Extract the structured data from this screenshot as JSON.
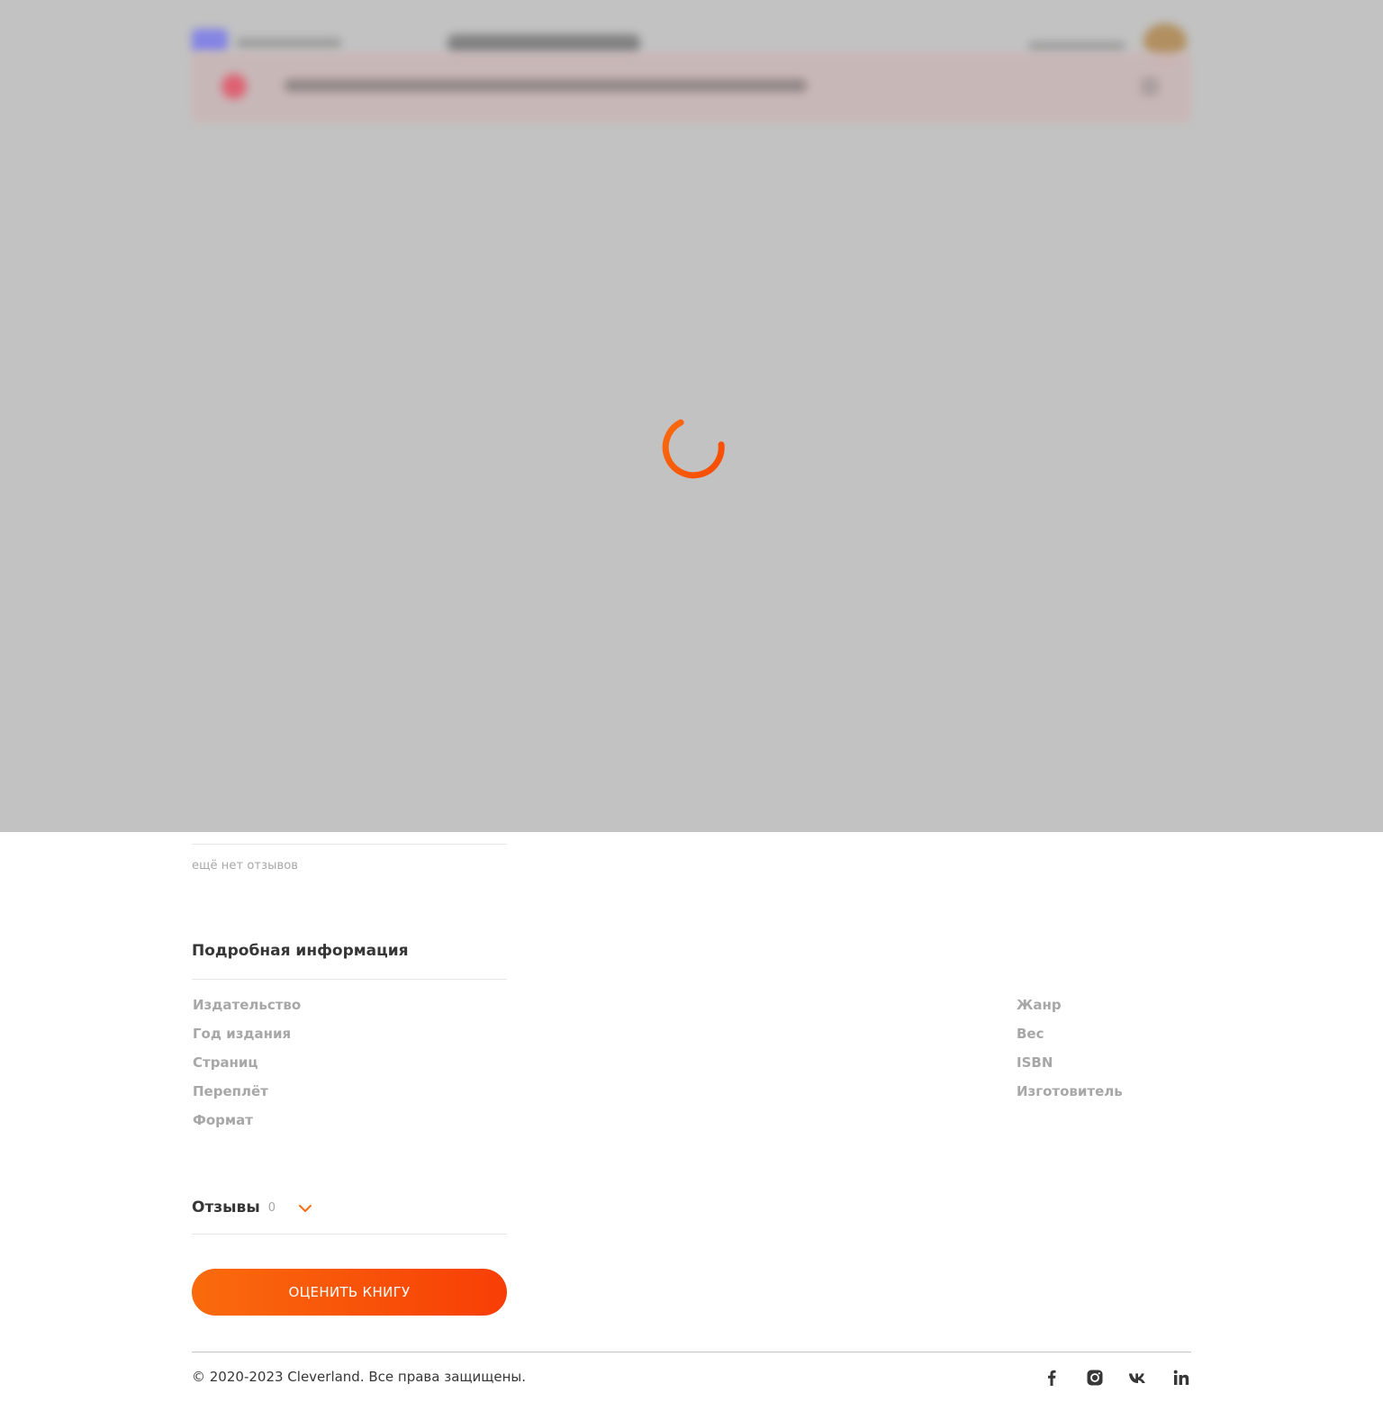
{
  "reviews_empty": {
    "text": "ещё нет отзывов"
  },
  "details": {
    "title": "Подробная информация",
    "left_labels": [
      "Издательство",
      "Год издания",
      "Страниц",
      "Переплёт",
      "Формат"
    ],
    "right_labels": [
      "Жанр",
      "Вес",
      "ISBN",
      "Изготовитель"
    ]
  },
  "reviews": {
    "title": "Отзывы",
    "count": "0"
  },
  "rate_button": {
    "label": "ОЦЕНИТЬ КНИГУ"
  },
  "footer": {
    "copyright": "© 2020-2023 Cleverland. Все права защищены.",
    "socials": [
      "facebook-icon",
      "instagram-icon",
      "vk-icon",
      "linkedin-icon"
    ]
  },
  "colors": {
    "accent": "#f96b0d",
    "accent_end": "#f83e05",
    "overlay": "#c2c2c2",
    "text": "#363636",
    "muted": "#a7a7a7"
  },
  "loader": {
    "state": "loading",
    "icon": "spinner-icon"
  }
}
